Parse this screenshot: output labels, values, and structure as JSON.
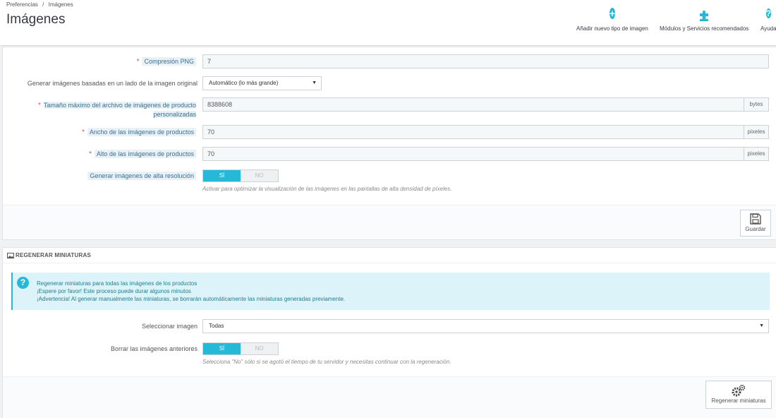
{
  "breadcrumb": {
    "parent": "Preferencias",
    "separator": "/",
    "current": "Imágenes"
  },
  "page_title": "Imágenes",
  "toolbar": {
    "add_label": "Añadir nuevo tipo de imagen",
    "modules_label": "Módulos y Servicios recomendados",
    "help_label": "Ayuda"
  },
  "settings": {
    "png_compression": {
      "label": "Compresión PNG",
      "value": "7"
    },
    "generate_based": {
      "label": "Generar imágenes basadas en un lado de la imagen original",
      "value": "Automático (lo más grande)"
    },
    "max_size": {
      "label_line1": "Tamaño máximo del archivo de imágenes de producto",
      "label_line2": "personalizadas",
      "value": "8388608",
      "addon": "bytes"
    },
    "width": {
      "label": "Ancho de las imágenes de productos",
      "value": "70",
      "addon": "pixeles"
    },
    "height": {
      "label": "Alto de las imágenes de productos",
      "value": "70",
      "addon": "pixeles"
    },
    "hires": {
      "label": "Generar imágenes de alta resolución",
      "on": "SÍ",
      "off": "NO",
      "help": "Activar para optimizar la visualización de las imágenes en las pantallas de alta densidad de píxeles."
    },
    "save_label": "Guardar"
  },
  "regen": {
    "heading": "REGENERAR MINIATURAS",
    "alert": [
      "Regenerar miniaturas para todas las imágenes de los productos",
      "¡Espere por favor! Este proceso puede durar algunos minutos",
      "¡Advertencia! Al generar manualmente las miniaturas, se borrarán automáticamente las miniaturas generadas previamente."
    ],
    "select_image": {
      "label": "Seleccionar imagen",
      "value": "Todas"
    },
    "erase_previous": {
      "label": "Borrar las imágenes anteriores",
      "on": "SÍ",
      "off": "NO",
      "help": "Selecciona \"No\" sólo si se agotó el tiempo de tu servidor y necesitas continuar con la regeneración."
    },
    "button_label": "Regenerar miniaturas"
  }
}
